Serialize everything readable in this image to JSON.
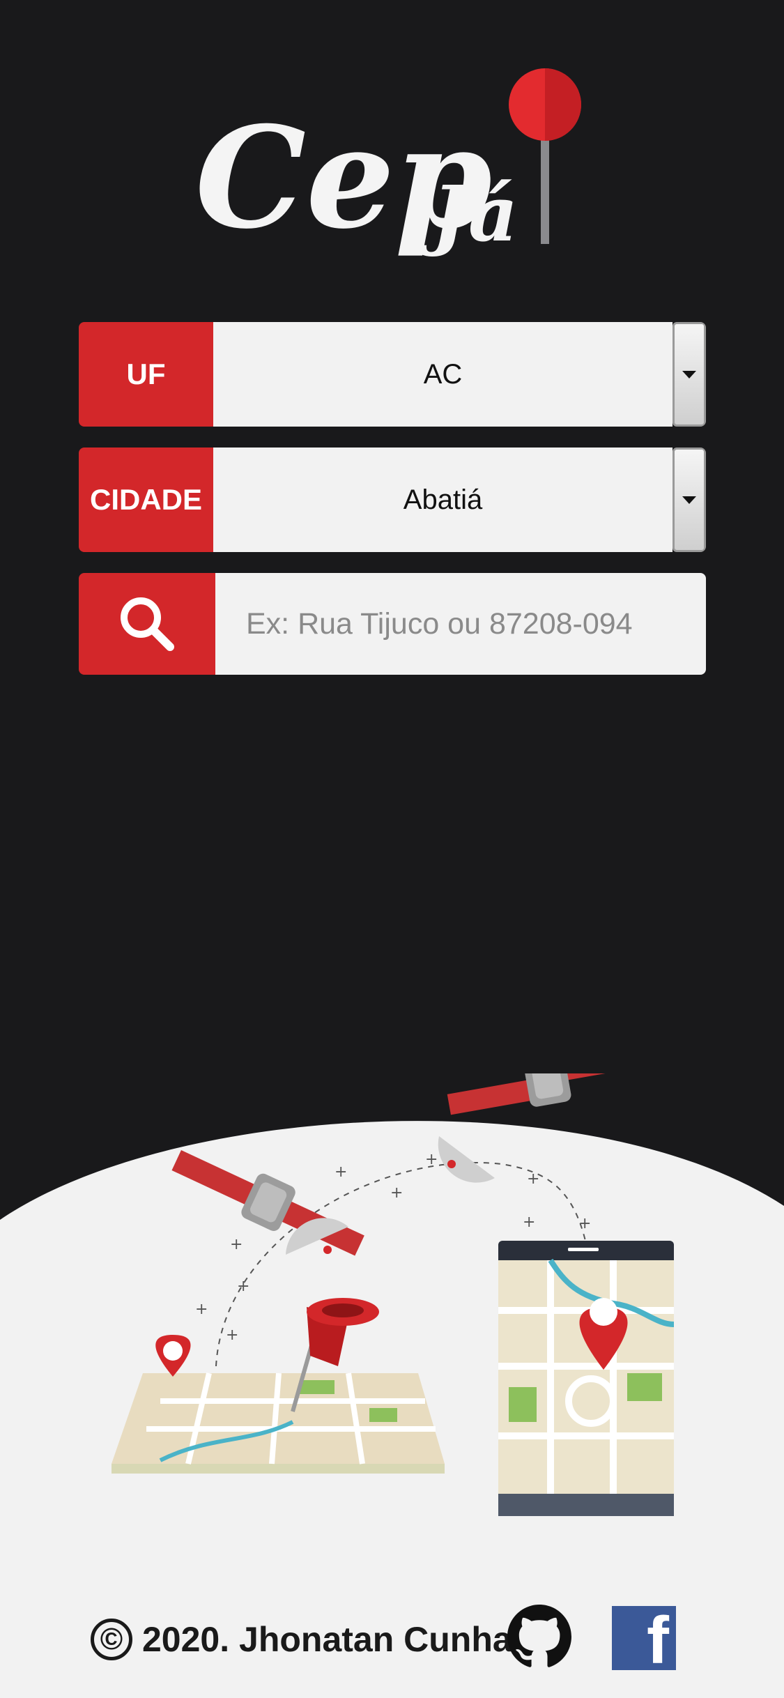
{
  "logo": {
    "text_main": "Cep",
    "text_sub": "Já"
  },
  "uf_field": {
    "label": "UF",
    "value": "AC"
  },
  "city_field": {
    "label": "CIDADE",
    "value": "Abatiá"
  },
  "search": {
    "placeholder": "Ex: Rua Tijuco ou 87208-094",
    "icon": "search-icon"
  },
  "footer": {
    "copyright_symbol": "©",
    "copyright_text": "2020. Jhonatan Cunha",
    "github_icon": "github-icon",
    "facebook_icon": "facebook-icon"
  },
  "colors": {
    "background": "#19191b",
    "accent": "#d3272a",
    "field_bg": "#f2f2f2",
    "facebook": "#3b5998"
  }
}
